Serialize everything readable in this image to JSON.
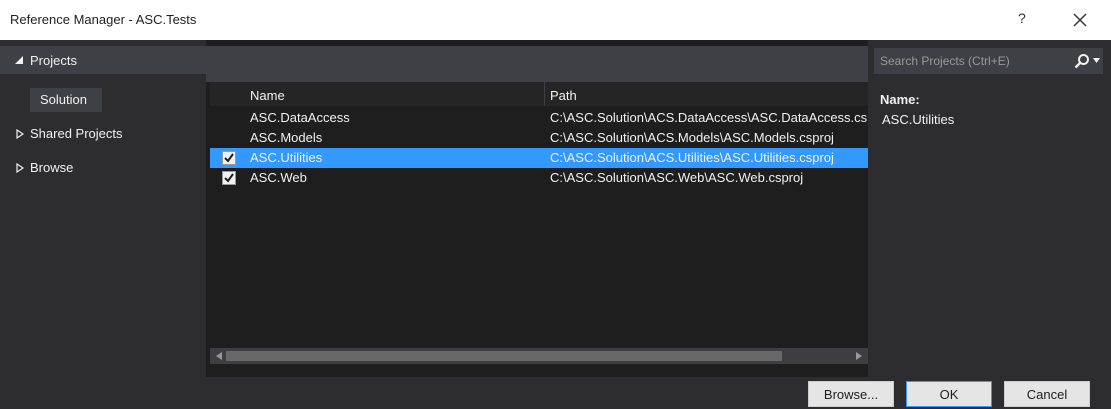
{
  "window": {
    "title": "Reference Manager - ASC.Tests",
    "help_label": "?"
  },
  "sidebar": {
    "projects_label": "Projects",
    "solution_label": "Solution",
    "shared_projects_label": "Shared Projects",
    "browse_label": "Browse"
  },
  "grid": {
    "columns": [
      "Name",
      "Path"
    ],
    "rows": [
      {
        "name": "ASC.DataAccess",
        "path": "C:\\ASC.Solution\\ACS.DataAccess\\ASC.DataAccess.csproj",
        "checked": false,
        "selected": false
      },
      {
        "name": "ASC.Models",
        "path": "C:\\ASC.Solution\\ACS.Models\\ASC.Models.csproj",
        "checked": false,
        "selected": false
      },
      {
        "name": "ASC.Utilities",
        "path": "C:\\ASC.Solution\\ACS.Utilities\\ASC.Utilities.csproj",
        "checked": true,
        "selected": true
      },
      {
        "name": "ASC.Web",
        "path": "C:\\ASC.Solution\\ASC.Web\\ASC.Web.csproj",
        "checked": true,
        "selected": false
      }
    ]
  },
  "search": {
    "placeholder": "Search Projects (Ctrl+E)"
  },
  "details": {
    "name_label": "Name:",
    "name_value": "ASC.Utilities"
  },
  "footer": {
    "browse_button": "Browse...",
    "ok_button": "OK",
    "cancel_button": "Cancel"
  },
  "colors": {
    "selection": "#3399ff",
    "background": "#2d2d30",
    "grid_background": "#1e1e1e"
  }
}
